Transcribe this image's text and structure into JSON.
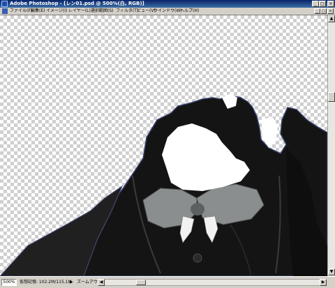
{
  "window": {
    "title": "Adobe Photoshop - [レン01.psd @ 500%(白, RGB)]",
    "min_glyph": "_",
    "max_glyph": "□",
    "close_glyph": "×"
  },
  "menu": {
    "items": [
      {
        "label": "ファイル(F)"
      },
      {
        "label": "編集(E)"
      },
      {
        "label": "イメージ(I)"
      },
      {
        "label": "レイヤー(L)"
      },
      {
        "label": "選択範囲(S)"
      },
      {
        "label": "フィルタ(T)"
      },
      {
        "label": "ビュー(V)"
      },
      {
        "label": "ウインドウ(W)"
      },
      {
        "label": "ヘルプ(H)"
      }
    ]
  },
  "status": {
    "zoom": "500%",
    "scratch": "仮想記憶: 102.2M/115.1M",
    "arrow": "▶",
    "tool_hint": "ズームアウト"
  },
  "scroll": {
    "up": "▲",
    "down": "▼",
    "left": "◀",
    "right": "▶",
    "v_position": 0.3,
    "h_position": 0.17
  },
  "colors": {
    "titlebar": "#0a246a",
    "coat": "#141414",
    "bow": "#8a8e8e"
  }
}
